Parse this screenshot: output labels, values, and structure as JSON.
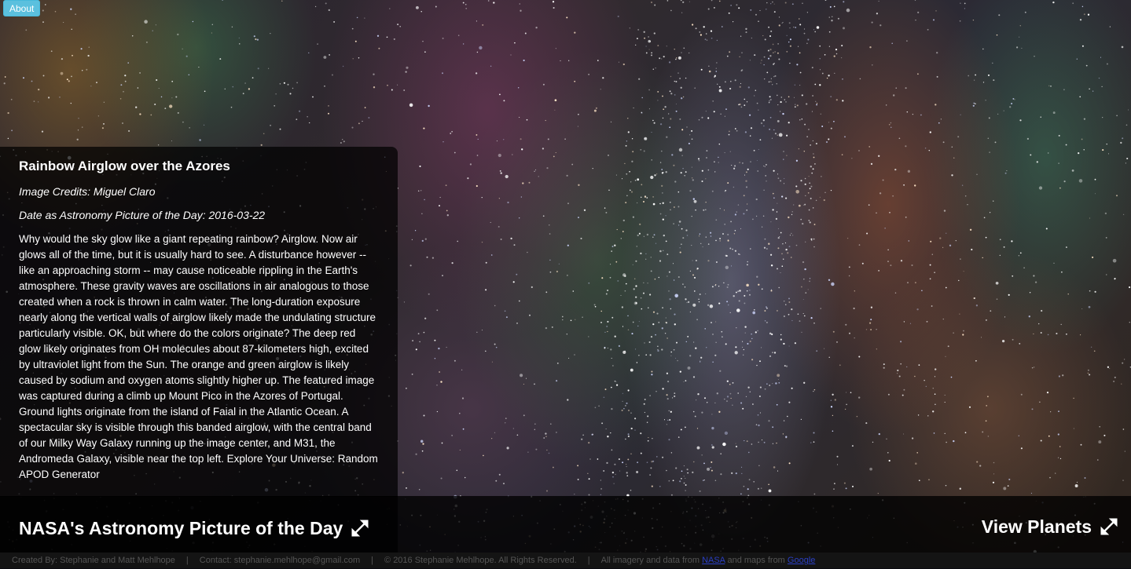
{
  "about_button": "About",
  "article": {
    "title": "Rainbow Airglow over the Azores",
    "credits": "Image Credits: Miguel Claro",
    "date": "Date as Astronomy Picture of the Day: 2016-03-22",
    "description": "Why would the sky glow like a giant repeating rainbow? Airglow. Now air glows all of the time, but it is usually hard to see. A disturbance however -- like an approaching storm -- may cause noticeable rippling in the Earth's atmosphere. These gravity waves are oscillations in air analogous to those created when a rock is thrown in calm water. The long-duration exposure nearly along the vertical walls of airglow likely made the undulating structure particularly visible. OK, but where do the colors originate? The deep red glow likely originates from OH molecules about 87-kilometers high, excited by ultraviolet light from the Sun. The orange and green airglow is likely caused by sodium and oxygen atoms slightly higher up. The featured image was captured during a climb up Mount Pico in the Azores of Portugal. Ground lights originate from the island of Faial in the Atlantic Ocean. A spectacular sky is visible through this banded airglow, with the central band of our Milky Way Galaxy running up the image center, and M31, the Andromeda Galaxy, visible near the top left. Explore Your Universe: Random APOD Generator"
  },
  "nav": {
    "apod_link": "NASA's Astronomy Picture of the Day",
    "planets_link": "View Planets"
  },
  "footer": {
    "created_by": "Created By: Stephanie and Matt Mehlhope",
    "contact": "Contact: stephanie.mehlhope@gmail.com",
    "copyright": "© 2016 Stephanie Mehlhope. All Rights Reserved.",
    "imagery_prefix": "All imagery and data from",
    "nasa_link": "NASA",
    "maps_prefix": "and maps from",
    "google_link": "Google",
    "separator": "|"
  },
  "colors": {
    "about_button": "#5bc0de",
    "footer_link": "#2a3fc4"
  },
  "icons": {
    "expand": "expand-icon"
  }
}
